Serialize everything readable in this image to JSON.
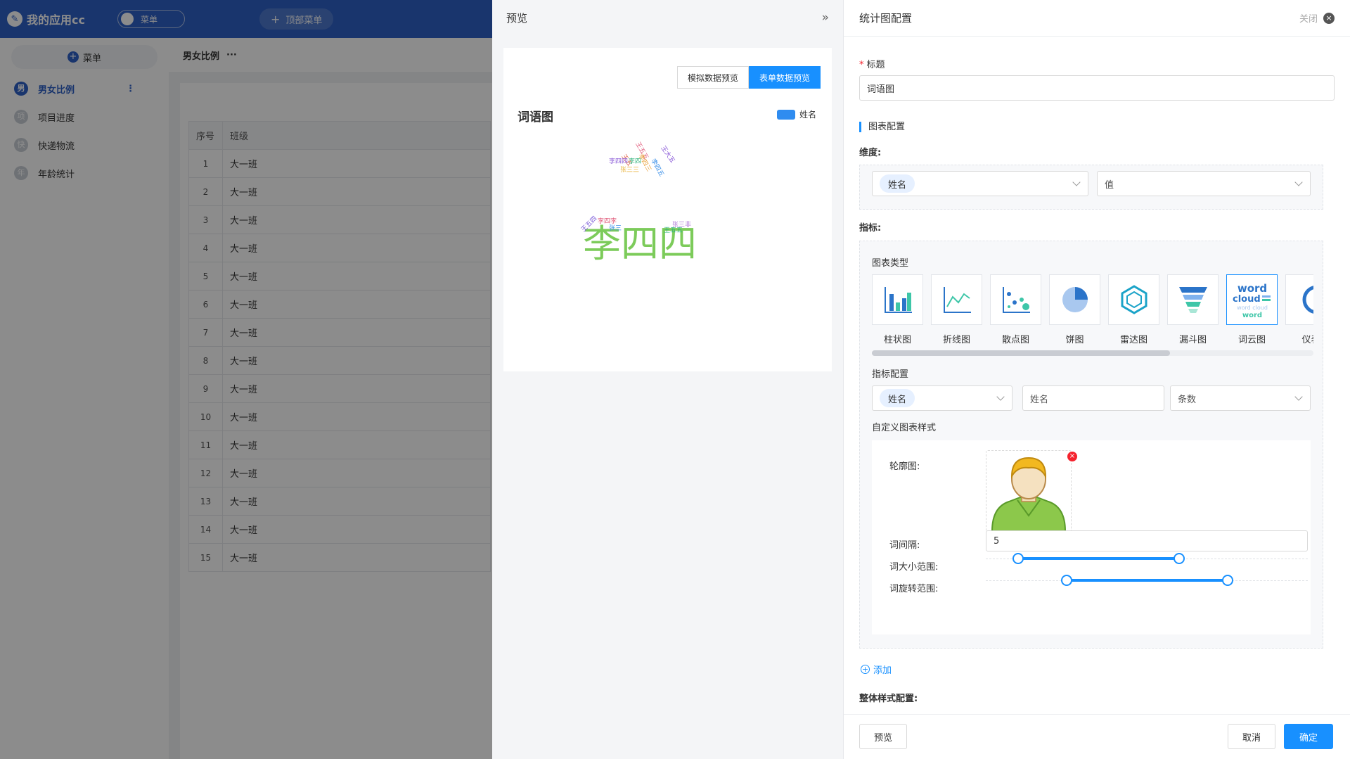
{
  "app": {
    "title": "我的应用cc",
    "menu_toggle": "菜单",
    "top_menu": "顶部菜单",
    "side_add": "菜单",
    "sidebar": [
      {
        "icon": "男",
        "label": "男女比例",
        "active": true
      },
      {
        "icon": "项",
        "label": "项目进度",
        "active": false
      },
      {
        "icon": "快",
        "label": "快递物流",
        "active": false
      },
      {
        "icon": "年",
        "label": "年龄统计",
        "active": false
      }
    ],
    "more_icon": "⋮",
    "page_title": "男女比例",
    "page_title_more": "···",
    "table": {
      "headers": [
        "序号",
        "班级"
      ],
      "rows": [
        [
          "1",
          "大一班"
        ],
        [
          "2",
          "大一班"
        ],
        [
          "3",
          "大一班"
        ],
        [
          "4",
          "大一班"
        ],
        [
          "5",
          "大一班"
        ],
        [
          "6",
          "大一班"
        ],
        [
          "7",
          "大一班"
        ],
        [
          "8",
          "大一班"
        ],
        [
          "9",
          "大一班"
        ],
        [
          "10",
          "大一班"
        ],
        [
          "11",
          "大一班"
        ],
        [
          "12",
          "大一班"
        ],
        [
          "13",
          "大一班"
        ],
        [
          "14",
          "大一班"
        ],
        [
          "15",
          "大一班"
        ]
      ]
    }
  },
  "preview": {
    "title": "预览",
    "collapse_icon": "»",
    "tabs": [
      {
        "label": "模拟数据预览",
        "active": false
      },
      {
        "label": "表单数据预览",
        "active": true
      }
    ],
    "chart_title": "词语图",
    "legend": "姓名"
  },
  "chart_data": {
    "type": "wordcloud",
    "title": "词语图",
    "legend": [
      "姓名"
    ],
    "words": [
      {
        "text": "李四四",
        "size": 54,
        "color": "#7ccb5a",
        "rotate": 0
      },
      {
        "text": "王五五",
        "size": 9,
        "color": "#e05a7a",
        "rotate": 60
      },
      {
        "text": "王大五",
        "size": 9,
        "color": "#8a5ad8",
        "rotate": 55
      },
      {
        "text": "王五",
        "size": 9,
        "color": "#e2674b",
        "rotate": 55
      },
      {
        "text": "李四三",
        "size": 9,
        "color": "#e8a23a",
        "rotate": 60
      },
      {
        "text": "李四五",
        "size": 9,
        "color": "#3a8fe8",
        "rotate": 60
      },
      {
        "text": "李四四",
        "size": 9,
        "color": "#8a5ad8",
        "rotate": 0
      },
      {
        "text": "李四",
        "size": 9,
        "color": "#2fb37a",
        "rotate": 0
      },
      {
        "text": "张三三",
        "size": 9,
        "color": "#e8b33a",
        "rotate": 0
      },
      {
        "text": "李四李",
        "size": 9,
        "color": "#e05a7a",
        "rotate": 0
      },
      {
        "text": "王五四",
        "size": 9,
        "color": "#7a5ad8",
        "rotate": -45
      },
      {
        "text": "张三",
        "size": 9,
        "color": "#3a8fe8",
        "rotate": 0
      },
      {
        "text": "张三非",
        "size": 9,
        "color": "#b07ad8",
        "rotate": 0
      },
      {
        "text": "王五五",
        "size": 9,
        "color": "#2fb37a",
        "rotate": 0
      }
    ]
  },
  "config": {
    "title": "统计图配置",
    "close_label": "关闭",
    "close_icon": "×",
    "title_label": "标题",
    "title_value": "词语图",
    "chart_config_heading": "图表配置",
    "dimension_label": "维度:",
    "dimension_tag": "姓名",
    "dimension_value_placeholder": "值",
    "metric_label": "指标:",
    "chart_type_label": "图表类型",
    "chart_types": [
      {
        "icon": "bar-chart-icon",
        "label": "柱状图",
        "active": false
      },
      {
        "icon": "line-chart-icon",
        "label": "折线图",
        "active": false
      },
      {
        "icon": "scatter-chart-icon",
        "label": "散点图",
        "active": false
      },
      {
        "icon": "pie-chart-icon",
        "label": "饼图",
        "active": false
      },
      {
        "icon": "radar-chart-icon",
        "label": "雷达图",
        "active": false
      },
      {
        "icon": "funnel-chart-icon",
        "label": "漏斗图",
        "active": false
      },
      {
        "icon": "wordcloud-chart-icon",
        "label": "词云图",
        "active": true
      },
      {
        "icon": "gauge-chart-icon",
        "label": "仪表",
        "active": false
      }
    ],
    "wordcloud_icon_text": [
      "word",
      "cloud",
      "word cloud",
      "word"
    ],
    "metric_config_label": "指标配置",
    "metric_tag": "姓名",
    "metric_name_value": "姓名",
    "metric_agg_value": "条数",
    "custom_style_label": "自定义图表样式",
    "outline_label": "轮廓图:",
    "remove_icon": "×",
    "word_gap_label": "词间隔:",
    "word_gap_value": "5",
    "word_size_label": "词大小范围:",
    "word_size_range": [
      0.1,
      0.6
    ],
    "word_rotate_label": "词旋转范围:",
    "word_rotate_range": [
      0.25,
      0.75
    ],
    "add_label": "添加",
    "add_icon": "+",
    "overall_style_label": "整体样式配置:",
    "footer": {
      "preview_button": "预览",
      "cancel_button": "取消",
      "confirm_button": "确定"
    }
  }
}
